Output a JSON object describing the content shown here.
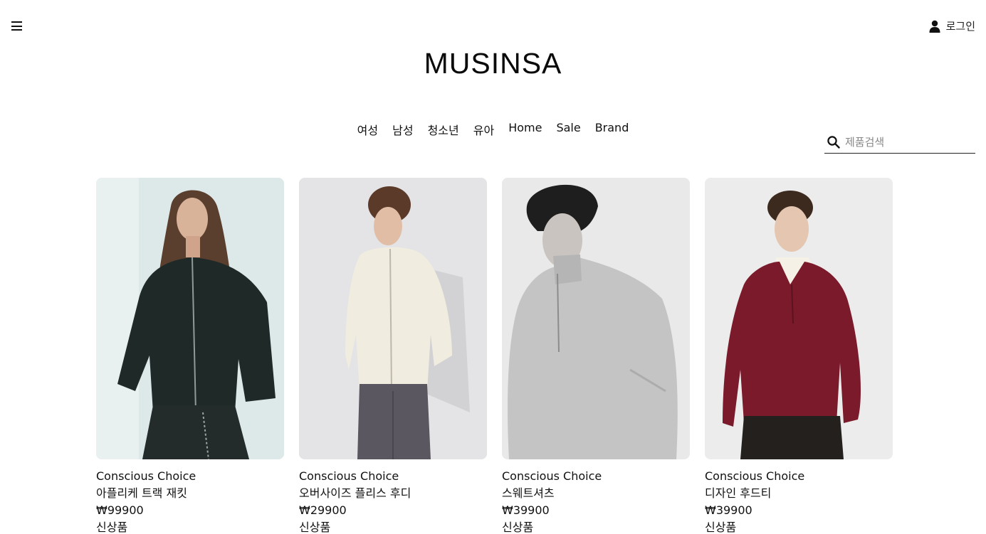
{
  "header": {
    "logo": "MUSINSA",
    "login_label": "로그인"
  },
  "nav": {
    "items": [
      "여성",
      "남성",
      "청소년",
      "유아",
      "Home",
      "Sale",
      "Brand"
    ]
  },
  "search": {
    "placeholder": "제품검색"
  },
  "products": [
    {
      "brand": "Conscious Choice",
      "name": "아플리케 트랙 재킷",
      "price": "₩99900",
      "badge": "신상품"
    },
    {
      "brand": "Conscious Choice",
      "name": "오버사이즈 플리스 후디",
      "price": "₩29900",
      "badge": "신상품"
    },
    {
      "brand": "Conscious Choice",
      "name": "스웨트셔츠",
      "price": "₩39900",
      "badge": "신상품"
    },
    {
      "brand": "Conscious Choice",
      "name": "디자인 후드티",
      "price": "₩39900",
      "badge": "신상품"
    }
  ],
  "colors": {
    "text": "#111111",
    "card_bg_1": "#dfe9ea",
    "card_bg_2": "#e6e6e8",
    "card_bg_3": "#e8e8e8",
    "card_bg_4": "#ededed"
  }
}
